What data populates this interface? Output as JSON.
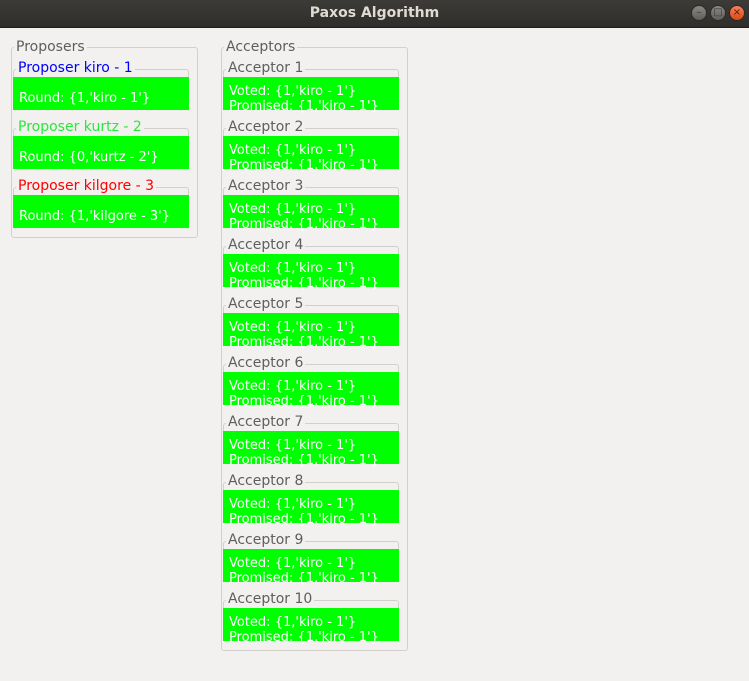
{
  "window": {
    "title": "Paxos Algorithm"
  },
  "proposers": {
    "title": "Proposers",
    "items": [
      {
        "label": "Proposer kiro - 1",
        "round": "Round: {1,'kiro - 1'}",
        "color": "#0000ff"
      },
      {
        "label": "Proposer kurtz - 2",
        "round": "Round: {0,'kurtz - 2'}",
        "color": "#28e83a"
      },
      {
        "label": "Proposer kilgore - 3",
        "round": "Round: {1,'kilgore - 3'}",
        "color": "#ff0000"
      }
    ]
  },
  "acceptors": {
    "title": "Acceptors",
    "items": [
      {
        "label": "Acceptor 1",
        "voted": "Voted: {1,'kiro - 1'}",
        "promised": "Promised: {1,'kiro - 1'}"
      },
      {
        "label": "Acceptor 2",
        "voted": "Voted: {1,'kiro - 1'}",
        "promised": "Promised: {1,'kiro - 1'}"
      },
      {
        "label": "Acceptor 3",
        "voted": "Voted: {1,'kiro - 1'}",
        "promised": "Promised: {1,'kiro - 1'}"
      },
      {
        "label": "Acceptor 4",
        "voted": "Voted: {1,'kiro - 1'}",
        "promised": "Promised: {1,'kiro - 1'}"
      },
      {
        "label": "Acceptor 5",
        "voted": "Voted: {1,'kiro - 1'}",
        "promised": "Promised: {1,'kiro - 1'}"
      },
      {
        "label": "Acceptor 6",
        "voted": "Voted: {1,'kiro - 1'}",
        "promised": "Promised: {1,'kiro - 1'}"
      },
      {
        "label": "Acceptor 7",
        "voted": "Voted: {1,'kiro - 1'}",
        "promised": "Promised: {1,'kiro - 1'}"
      },
      {
        "label": "Acceptor 8",
        "voted": "Voted: {1,'kiro - 1'}",
        "promised": "Promised: {1,'kiro - 1'}"
      },
      {
        "label": "Acceptor 9",
        "voted": "Voted: {1,'kiro - 1'}",
        "promised": "Promised: {1,'kiro - 1'}"
      },
      {
        "label": "Acceptor 10",
        "voted": "Voted: {1,'kiro - 1'}",
        "promised": "Promised: {1,'kiro - 1'}"
      }
    ]
  },
  "colors": {
    "status_fill": "#00ff00",
    "status_text": "#ffffff",
    "acceptor_label": "#5e5e5e"
  },
  "icons": {
    "minimize": "minimize-icon",
    "maximize": "maximize-icon",
    "close": "close-icon"
  }
}
